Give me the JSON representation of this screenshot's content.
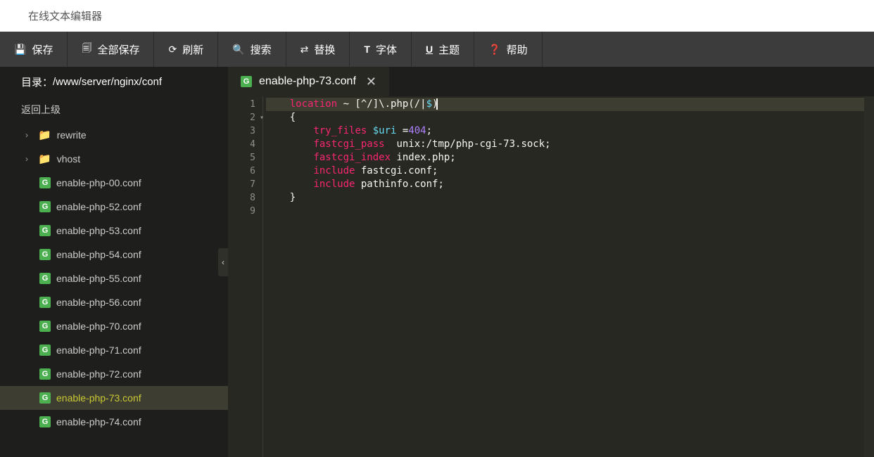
{
  "title": "在线文本编辑器",
  "toolbar": {
    "save": "保存",
    "saveAll": "全部保存",
    "refresh": "刷新",
    "search": "搜索",
    "replace": "替换",
    "font": "字体",
    "theme": "主题",
    "help": "帮助"
  },
  "sidebar": {
    "dirLabel": "目录：",
    "dirPath": "/www/server/nginx/conf",
    "backUp": "返回上级",
    "folders": [
      {
        "name": "rewrite"
      },
      {
        "name": "vhost"
      }
    ],
    "files": [
      {
        "name": "enable-php-00.conf",
        "active": false
      },
      {
        "name": "enable-php-52.conf",
        "active": false
      },
      {
        "name": "enable-php-53.conf",
        "active": false
      },
      {
        "name": "enable-php-54.conf",
        "active": false
      },
      {
        "name": "enable-php-55.conf",
        "active": false
      },
      {
        "name": "enable-php-56.conf",
        "active": false
      },
      {
        "name": "enable-php-70.conf",
        "active": false
      },
      {
        "name": "enable-php-71.conf",
        "active": false
      },
      {
        "name": "enable-php-72.conf",
        "active": false
      },
      {
        "name": "enable-php-73.conf",
        "active": true
      },
      {
        "name": "enable-php-74.conf",
        "active": false
      }
    ]
  },
  "tab": {
    "name": "enable-php-73.conf"
  },
  "code": {
    "lines": [
      {
        "n": 1,
        "indent": "    ",
        "tokens": [
          [
            "kw",
            "location"
          ],
          [
            "plain",
            " ~ [^/]\\.php(/|"
          ],
          [
            "var",
            "$"
          ],
          [
            "plain",
            ")"
          ]
        ]
      },
      {
        "n": 2,
        "indent": "    ",
        "fold": true,
        "tokens": [
          [
            "plain",
            "{"
          ]
        ]
      },
      {
        "n": 3,
        "indent": "        ",
        "tokens": [
          [
            "kw",
            "try_files"
          ],
          [
            "plain",
            " "
          ],
          [
            "var",
            "$uri"
          ],
          [
            "plain",
            " ="
          ],
          [
            "num",
            "404"
          ],
          [
            "plain",
            ";"
          ]
        ]
      },
      {
        "n": 4,
        "indent": "        ",
        "tokens": [
          [
            "kw",
            "fastcgi_pass"
          ],
          [
            "plain",
            "  unix:/tmp/php-cgi-73.sock;"
          ]
        ]
      },
      {
        "n": 5,
        "indent": "        ",
        "tokens": [
          [
            "kw",
            "fastcgi_index"
          ],
          [
            "plain",
            " index.php;"
          ]
        ]
      },
      {
        "n": 6,
        "indent": "        ",
        "tokens": [
          [
            "kw",
            "include"
          ],
          [
            "plain",
            " fastcgi.conf;"
          ]
        ]
      },
      {
        "n": 7,
        "indent": "        ",
        "tokens": [
          [
            "kw",
            "include"
          ],
          [
            "plain",
            " pathinfo.conf;"
          ]
        ]
      },
      {
        "n": 8,
        "indent": "    ",
        "tokens": [
          [
            "plain",
            "}"
          ]
        ]
      },
      {
        "n": 9,
        "indent": "",
        "tokens": []
      }
    ]
  }
}
